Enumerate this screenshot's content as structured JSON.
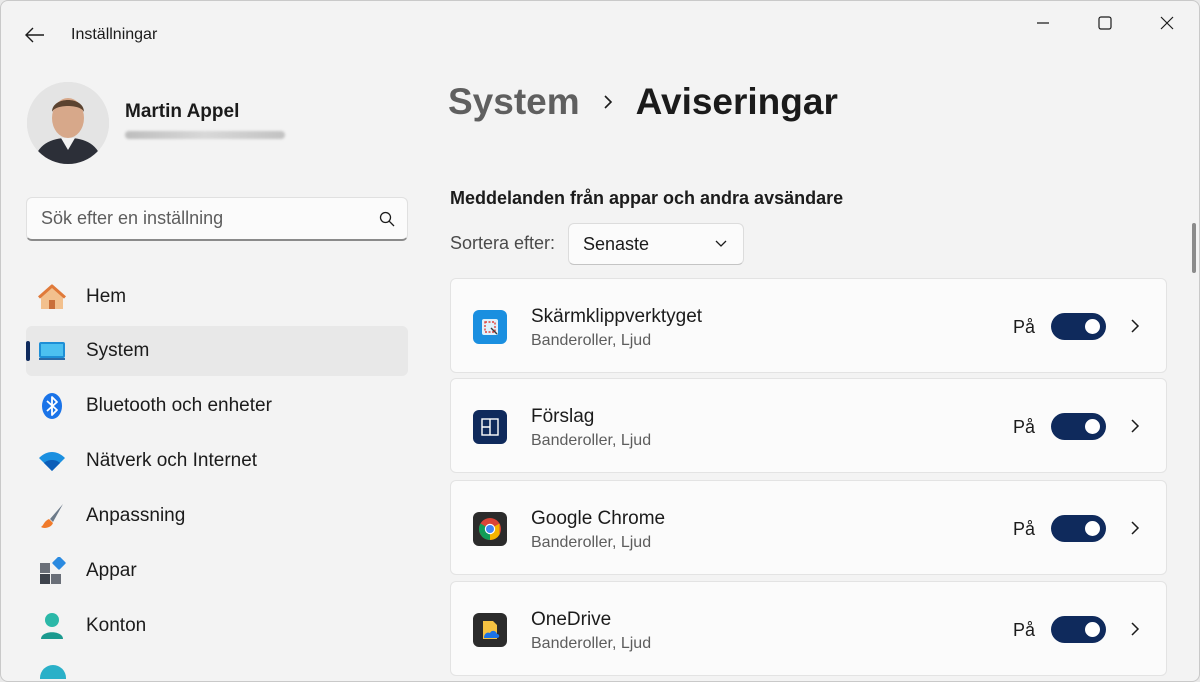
{
  "window": {
    "title": "Inställningar",
    "controls": [
      "minimize",
      "maximize",
      "close"
    ]
  },
  "profile": {
    "name": "Martin Appel"
  },
  "search": {
    "placeholder": "Sök efter en inställning"
  },
  "sidebar": {
    "items": [
      {
        "label": "Hem",
        "icon": "home-icon"
      },
      {
        "label": "System",
        "icon": "system-icon",
        "active": true
      },
      {
        "label": "Bluetooth och enheter",
        "icon": "bluetooth-icon"
      },
      {
        "label": "Nätverk och Internet",
        "icon": "wifi-icon"
      },
      {
        "label": "Anpassning",
        "icon": "brush-icon"
      },
      {
        "label": "Appar",
        "icon": "apps-icon"
      },
      {
        "label": "Konton",
        "icon": "account-icon"
      }
    ]
  },
  "breadcrumb": {
    "parent": "System",
    "current": "Aviseringar"
  },
  "notifications": {
    "section_title": "Meddelanden från appar och andra avsändare",
    "sort_label": "Sortera efter:",
    "sort_value": "Senaste",
    "apps": [
      {
        "name": "Skärmklippverktyget",
        "subtitle": "Banderoller, Ljud",
        "state": "På",
        "enabled": true,
        "icon": "snipping-tool-icon"
      },
      {
        "name": "Förslag",
        "subtitle": "Banderoller, Ljud",
        "state": "På",
        "enabled": true,
        "icon": "suggestions-icon"
      },
      {
        "name": "Google Chrome",
        "subtitle": "Banderoller, Ljud",
        "state": "På",
        "enabled": true,
        "icon": "chrome-icon"
      },
      {
        "name": "OneDrive",
        "subtitle": "Banderoller, Ljud",
        "state": "På",
        "enabled": true,
        "icon": "onedrive-icon"
      }
    ]
  },
  "colors": {
    "accent": "#0f2a5c",
    "background": "#f3f3f3",
    "card": "#fbfbfb"
  }
}
